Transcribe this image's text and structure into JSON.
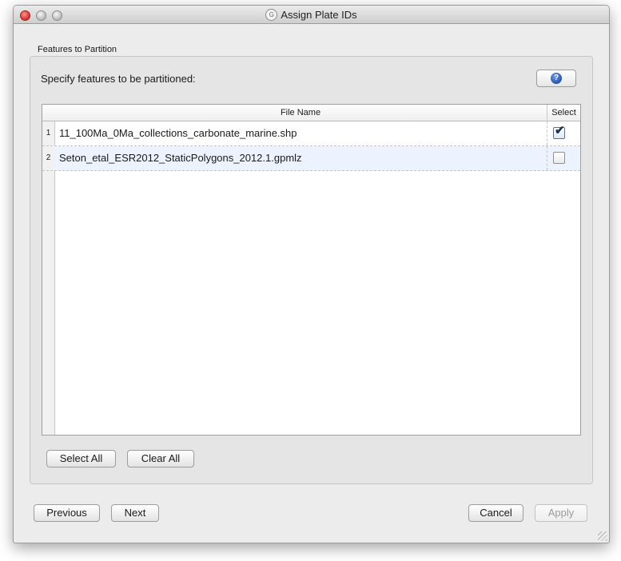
{
  "window": {
    "title": "Assign Plate IDs",
    "app_icon": "gplates-icon"
  },
  "group": {
    "label": "Features to Partition",
    "instruction": "Specify features to be partitioned:"
  },
  "help_button": {
    "icon": "help-icon",
    "glyph": "?"
  },
  "table": {
    "columns": {
      "file_name": "File Name",
      "select": "Select"
    },
    "rows": [
      {
        "num": "1",
        "file": "11_100Ma_0Ma_collections_carbonate_marine.shp",
        "selected": true
      },
      {
        "num": "2",
        "file": "Seton_etal_ESR2012_StaticPolygons_2012.1.gpmlz",
        "selected": false
      }
    ]
  },
  "buttons": {
    "select_all": "Select All",
    "clear_all": "Clear All",
    "previous": "Previous",
    "next": "Next",
    "cancel": "Cancel",
    "apply": "Apply"
  },
  "colors": {
    "close": "#d6322a",
    "selected_row": "#edf3fe",
    "help_blue": "#1e4fa8"
  }
}
